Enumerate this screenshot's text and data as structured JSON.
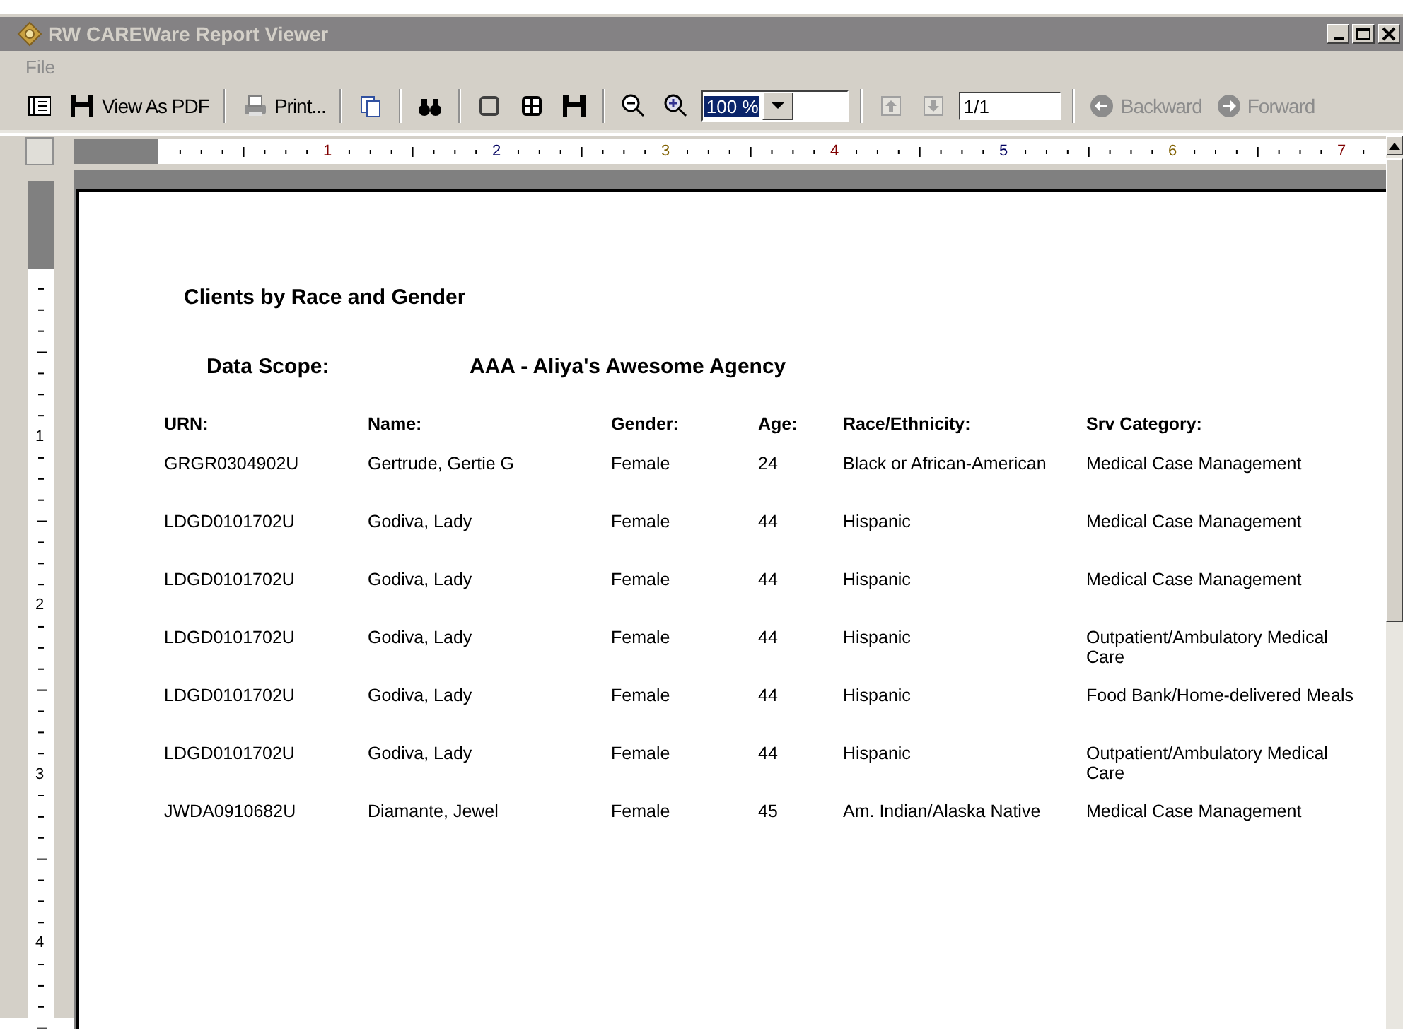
{
  "window": {
    "title": "RW CAREWare Report Viewer"
  },
  "menu": [
    {
      "label": "File"
    }
  ],
  "toolbar": {
    "view_pdf": "View As PDF",
    "print": "Print...",
    "zoom": "100 %",
    "page": "1/1",
    "nav": [
      {
        "label": "Backward",
        "disabled": true
      },
      {
        "label": "Forward",
        "disabled": true
      }
    ]
  },
  "ruler": {
    "horizontal": [
      "1",
      "2",
      "3",
      "4",
      "5",
      "6",
      "7"
    ],
    "vertical": [
      "1",
      "2",
      "3",
      "4"
    ]
  },
  "report": {
    "title": "Clients by Race and Gender",
    "scope_label": "Data Scope:",
    "scope_value": "AAA - Aliya's Awesome Agency",
    "columns": [
      "URN:",
      "Name:",
      "Gender:",
      "Age:",
      "Race/Ethnicity:",
      "Srv Category:"
    ],
    "rows": [
      [
        "GRGR0304902U",
        "Gertrude, Gertie G",
        "Female",
        "24",
        "Black or African-American",
        "Medical Case Management"
      ],
      [
        "LDGD0101702U",
        "Godiva, Lady",
        "Female",
        "44",
        "Hispanic",
        "Medical Case Management"
      ],
      [
        "LDGD0101702U",
        "Godiva, Lady",
        "Female",
        "44",
        "Hispanic",
        "Medical Case Management"
      ],
      [
        "LDGD0101702U",
        "Godiva, Lady",
        "Female",
        "44",
        "Hispanic",
        "Outpatient/Ambulatory Medical Care"
      ],
      [
        "LDGD0101702U",
        "Godiva, Lady",
        "Female",
        "44",
        "Hispanic",
        "Food Bank/Home-delivered Meals"
      ],
      [
        "LDGD0101702U",
        "Godiva, Lady",
        "Female",
        "44",
        "Hispanic",
        "Outpatient/Ambulatory Medical Care"
      ],
      [
        "JWDA0910682U",
        "Diamante, Jewel",
        "Female",
        "45",
        "Am. Indian/Alaska Native",
        "Medical Case Management"
      ]
    ]
  }
}
